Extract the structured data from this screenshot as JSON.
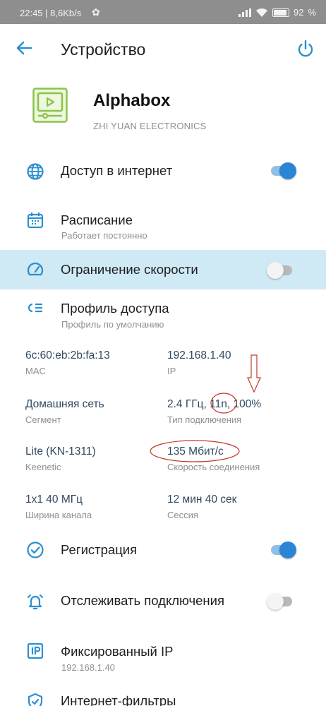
{
  "statusbar": {
    "time": "22:45",
    "speed": "8,6Kb/s",
    "battery": "92"
  },
  "appbar": {
    "title": "Устройство"
  },
  "device": {
    "name": "Alphabox",
    "vendor": "ZHI YUAN ELECTRONICS"
  },
  "rows": {
    "internet": {
      "label": "Доступ в интернет",
      "on": true
    },
    "schedule": {
      "label": "Расписание",
      "sub": "Работает постоянно"
    },
    "speed_limit": {
      "label": "Ограничение скорости",
      "on": false
    },
    "profile": {
      "label": "Профиль доступа",
      "sub": "Профиль по умолчанию"
    },
    "registration": {
      "label": "Регистрация",
      "on": true
    },
    "track": {
      "label": "Отслеживать подключения",
      "on": false
    },
    "fixed_ip": {
      "label": "Фиксированный IP",
      "sub": "192.168.1.40"
    },
    "filters": {
      "label": "Интернет-фильтры"
    }
  },
  "info": {
    "mac": {
      "value": "6c:60:eb:2b:fa:13",
      "key": "MAC"
    },
    "ip": {
      "value": "192.168.1.40",
      "key": "IP"
    },
    "segment": {
      "value": "Домашняя сеть",
      "key": "Сегмент"
    },
    "conn_type": {
      "value": "2.4 ГГц, 11n, 100%",
      "key": "Тип подключения"
    },
    "ap": {
      "value": "Lite (KN-1311)",
      "key": "Keenetic"
    },
    "link_speed": {
      "value": "135 Мбит/с",
      "key": "Скорость соединения"
    },
    "width": {
      "value": "1x1 40 МГц",
      "key": "Ширина канала"
    },
    "session": {
      "value": "12 мин 40 сек",
      "key": "Сессия"
    }
  },
  "colors": {
    "accent": "#2a86d4",
    "icon": "#2c8fd0",
    "highlight": "#cfe9f5",
    "annotation": "#c0392b"
  }
}
